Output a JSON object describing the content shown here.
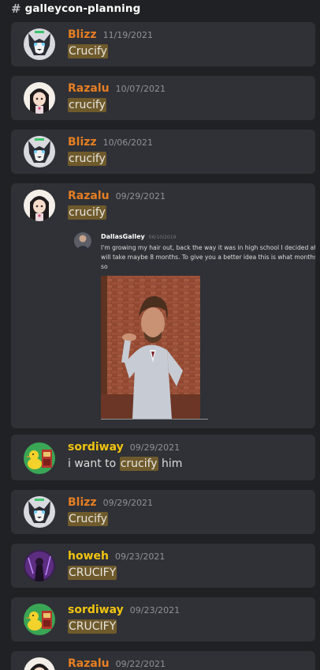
{
  "channel": {
    "hash": "#",
    "name": "galleycon-planning"
  },
  "results": [
    {
      "author": "Blizz",
      "date": "11/19/2021",
      "author_color": "#e67e22",
      "avatar": "wolf-avatar",
      "pre": "",
      "match": "Crucify",
      "post": ""
    },
    {
      "author": "Razalu",
      "date": "10/07/2021",
      "author_color": "#e67e22",
      "avatar": "anime-girl-avatar",
      "pre": "",
      "match": "crucify",
      "post": ""
    },
    {
      "author": "Blizz",
      "date": "10/06/2021",
      "author_color": "#e67e22",
      "avatar": "wolf-avatar",
      "pre": "",
      "match": "crucify",
      "post": ""
    },
    {
      "author": "Razalu",
      "date": "09/29/2021",
      "author_color": "#e67e22",
      "avatar": "anime-girl-avatar",
      "pre": "",
      "match": "crucify",
      "post": "",
      "quote": {
        "author": "DallasGalley",
        "date": "06/10/2019",
        "text": "I'm growing my hair out, back the way it was in high school I decided at it will take maybe 8 months. To give you a better idea this is what months or so"
      }
    },
    {
      "author": "sordiway",
      "date": "09/29/2021",
      "author_color": "#f1c40f",
      "avatar": "duck-avatar",
      "pre": "i want to ",
      "match": "crucify",
      "post": " him"
    },
    {
      "author": "Blizz",
      "date": "09/29/2021",
      "author_color": "#e67e22",
      "avatar": "wolf-avatar",
      "pre": "",
      "match": "Crucify",
      "post": ""
    },
    {
      "author": "howeh",
      "date": "09/23/2021",
      "author_color": "#f1c40f",
      "avatar": "purple-figure-avatar",
      "pre": "",
      "match": "CRUCIFY",
      "post": ""
    },
    {
      "author": "sordiway",
      "date": "09/23/2021",
      "author_color": "#f1c40f",
      "avatar": "duck-avatar",
      "pre": "",
      "match": "CRUCIFY",
      "post": ""
    },
    {
      "author": "Razalu",
      "date": "09/22/2021",
      "author_color": "#e67e22",
      "avatar": "anime-girl-avatar",
      "pre": "",
      "match": "",
      "post": ""
    }
  ],
  "colors": {
    "background": "#202124",
    "card": "#2f3136",
    "highlight": "#6f5a2c"
  }
}
